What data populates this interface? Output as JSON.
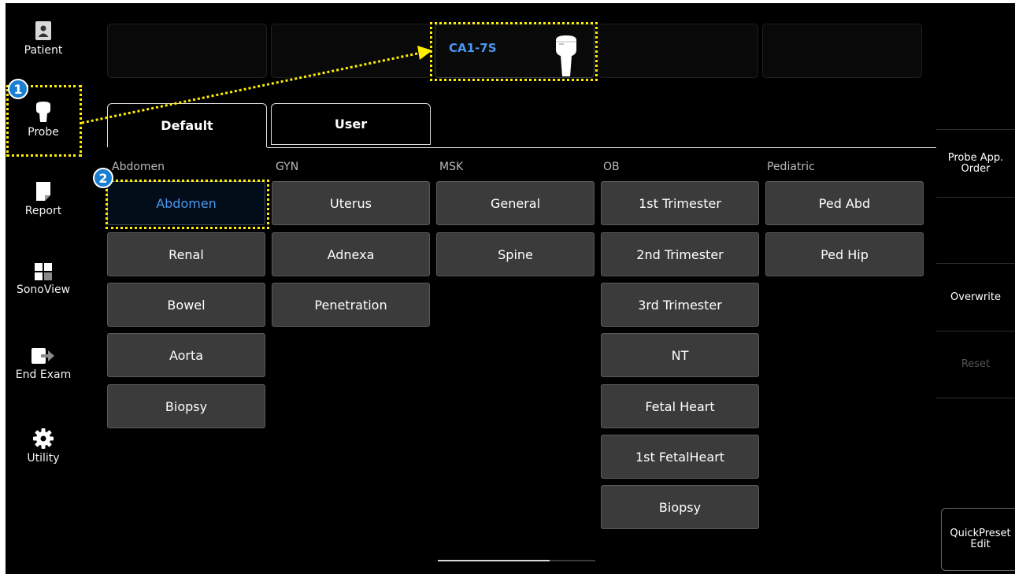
{
  "sidebar": {
    "items": [
      {
        "label": "Patient",
        "icon": "patient-icon"
      },
      {
        "label": "Probe",
        "icon": "probe-icon"
      },
      {
        "label": "Report",
        "icon": "report-icon"
      },
      {
        "label": "SonoView",
        "icon": "sonoview-icon"
      },
      {
        "label": "End Exam",
        "icon": "end-exam-icon"
      },
      {
        "label": "Utility",
        "icon": "gear-icon"
      }
    ]
  },
  "probes": {
    "active_name": "CA1-7S",
    "active_slot": 3
  },
  "tabs": [
    {
      "label": "Default",
      "active": true
    },
    {
      "label": "User",
      "active": false
    }
  ],
  "columns": [
    {
      "category": "Abdomen",
      "items": [
        "Abdomen",
        "Renal",
        "Bowel",
        "Aorta",
        "Biopsy"
      ]
    },
    {
      "category": "GYN",
      "items": [
        "Uterus",
        "Adnexa",
        "Penetration"
      ]
    },
    {
      "category": "MSK",
      "items": [
        "General",
        "Spine"
      ]
    },
    {
      "category": "OB",
      "items": [
        "1st Trimester",
        "2nd Trimester",
        "3rd Trimester",
        "NT",
        "Fetal Heart",
        "1st FetalHeart",
        "Biopsy"
      ]
    },
    {
      "category": "Pediatric",
      "items": [
        "Ped Abd",
        "Ped Hip"
      ]
    }
  ],
  "selected_preset": "Abdomen",
  "right_panel": {
    "probe_app_order": [
      "Probe App.",
      "Order"
    ],
    "overwrite": "Overwrite",
    "reset": "Reset",
    "quickpreset_edit": [
      "QuickPreset",
      "Edit"
    ]
  },
  "annotations": {
    "badge_1": "1",
    "badge_2": "2"
  },
  "colors": {
    "accent": "#4b97f0",
    "highlight": "#ffee00",
    "badge": "#1a7fd0",
    "button": "#3b3b3b"
  }
}
